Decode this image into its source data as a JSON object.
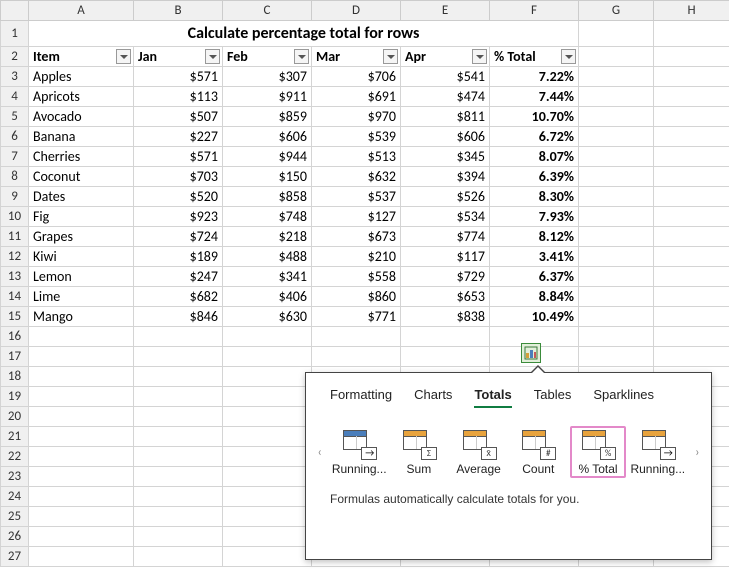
{
  "title": "Calculate percentage total for rows",
  "cols": [
    "A",
    "B",
    "C",
    "D",
    "E",
    "F",
    "G",
    "H"
  ],
  "headers": {
    "item": "Item",
    "jan": "Jan",
    "feb": "Feb",
    "mar": "Mar",
    "apr": "Apr",
    "pct": "% Total"
  },
  "rows": [
    {
      "n": "3",
      "item": "Apples",
      "jan": "$571",
      "feb": "$307",
      "mar": "$706",
      "apr": "$541",
      "pct": "7.22%"
    },
    {
      "n": "4",
      "item": "Apricots",
      "jan": "$113",
      "feb": "$911",
      "mar": "$691",
      "apr": "$474",
      "pct": "7.44%"
    },
    {
      "n": "5",
      "item": "Avocado",
      "jan": "$507",
      "feb": "$859",
      "mar": "$970",
      "apr": "$811",
      "pct": "10.70%"
    },
    {
      "n": "6",
      "item": "Banana",
      "jan": "$227",
      "feb": "$606",
      "mar": "$539",
      "apr": "$606",
      "pct": "6.72%"
    },
    {
      "n": "7",
      "item": "Cherries",
      "jan": "$571",
      "feb": "$944",
      "mar": "$513",
      "apr": "$345",
      "pct": "8.07%"
    },
    {
      "n": "8",
      "item": "Coconut",
      "jan": "$703",
      "feb": "$150",
      "mar": "$632",
      "apr": "$394",
      "pct": "6.39%"
    },
    {
      "n": "9",
      "item": "Dates",
      "jan": "$520",
      "feb": "$858",
      "mar": "$537",
      "apr": "$526",
      "pct": "8.30%"
    },
    {
      "n": "10",
      "item": "Fig",
      "jan": "$923",
      "feb": "$748",
      "mar": "$127",
      "apr": "$534",
      "pct": "7.93%"
    },
    {
      "n": "11",
      "item": "Grapes",
      "jan": "$724",
      "feb": "$218",
      "mar": "$673",
      "apr": "$774",
      "pct": "8.12%"
    },
    {
      "n": "12",
      "item": "Kiwi",
      "jan": "$189",
      "feb": "$488",
      "mar": "$210",
      "apr": "$117",
      "pct": "3.41%"
    },
    {
      "n": "13",
      "item": "Lemon",
      "jan": "$247",
      "feb": "$341",
      "mar": "$558",
      "apr": "$729",
      "pct": "6.37%"
    },
    {
      "n": "14",
      "item": "Lime",
      "jan": "$682",
      "feb": "$406",
      "mar": "$860",
      "apr": "$653",
      "pct": "8.84%"
    },
    {
      "n": "15",
      "item": "Mango",
      "jan": "$846",
      "feb": "$630",
      "mar": "$771",
      "apr": "$838",
      "pct": "10.49%"
    }
  ],
  "popup": {
    "tabs": {
      "formatting": "Formatting",
      "charts": "Charts",
      "totals": "Totals",
      "tables": "Tables",
      "sparklines": "Sparklines"
    },
    "opts": {
      "running1": "Running...",
      "sum": "Sum",
      "average": "Average",
      "count": "Count",
      "pct_total": "% Total",
      "running2": "Running..."
    },
    "badge": {
      "sum": "Σ",
      "avg": "x̄",
      "count": "#",
      "pct": "%"
    },
    "hint": "Formulas automatically calculate totals for you."
  },
  "chart_data": {
    "type": "table",
    "title": "Calculate percentage total for rows",
    "columns": [
      "Item",
      "Jan",
      "Feb",
      "Mar",
      "Apr",
      "% Total"
    ],
    "rows": [
      [
        "Apples",
        571,
        307,
        706,
        541,
        7.22
      ],
      [
        "Apricots",
        113,
        911,
        691,
        474,
        7.44
      ],
      [
        "Avocado",
        507,
        859,
        970,
        811,
        10.7
      ],
      [
        "Banana",
        227,
        606,
        539,
        606,
        6.72
      ],
      [
        "Cherries",
        571,
        944,
        513,
        345,
        8.07
      ],
      [
        "Coconut",
        703,
        150,
        632,
        394,
        6.39
      ],
      [
        "Dates",
        520,
        858,
        537,
        526,
        8.3
      ],
      [
        "Fig",
        923,
        748,
        127,
        534,
        7.93
      ],
      [
        "Grapes",
        724,
        218,
        673,
        774,
        8.12
      ],
      [
        "Kiwi",
        189,
        488,
        210,
        117,
        3.41
      ],
      [
        "Lemon",
        247,
        341,
        558,
        729,
        6.37
      ],
      [
        "Lime",
        682,
        406,
        860,
        653,
        8.84
      ],
      [
        "Mango",
        846,
        630,
        771,
        838,
        10.49
      ]
    ]
  }
}
